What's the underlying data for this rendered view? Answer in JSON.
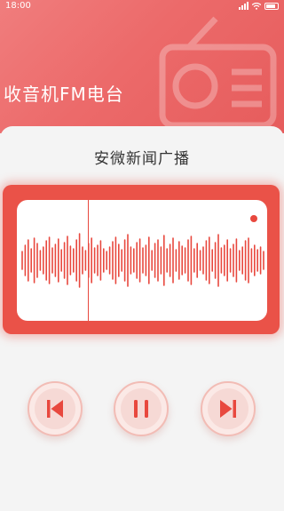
{
  "status": {
    "time": "18:00"
  },
  "app": {
    "title": "收音机FM电台"
  },
  "station": {
    "name": "安微新闻广播"
  },
  "player": {
    "waveform": [
      20,
      34,
      46,
      26,
      50,
      38,
      22,
      30,
      44,
      52,
      28,
      36,
      48,
      24,
      40,
      54,
      32,
      26,
      46,
      60,
      30,
      22,
      38,
      50,
      28,
      34,
      44,
      26,
      20,
      30,
      42,
      52,
      36,
      24,
      46,
      58,
      30,
      26,
      40,
      48,
      28,
      34,
      52,
      22,
      38,
      46,
      30,
      56,
      26,
      36,
      50,
      24,
      42,
      32,
      28,
      46,
      54,
      26,
      38,
      22,
      30,
      44,
      52,
      24,
      40,
      58,
      28,
      34,
      46,
      26,
      36,
      48,
      22,
      30,
      44,
      50,
      26,
      34,
      24,
      30,
      20
    ],
    "controls": [
      "previous",
      "pause",
      "next"
    ]
  },
  "colors": {
    "accent": "#e8483e",
    "header": "#ec6a6a"
  },
  "icons": {
    "prev": "skip-back-icon",
    "pause": "pause-icon",
    "next": "skip-forward-icon",
    "signal": "signal-icon",
    "wifi": "wifi-icon",
    "battery": "battery-icon"
  }
}
